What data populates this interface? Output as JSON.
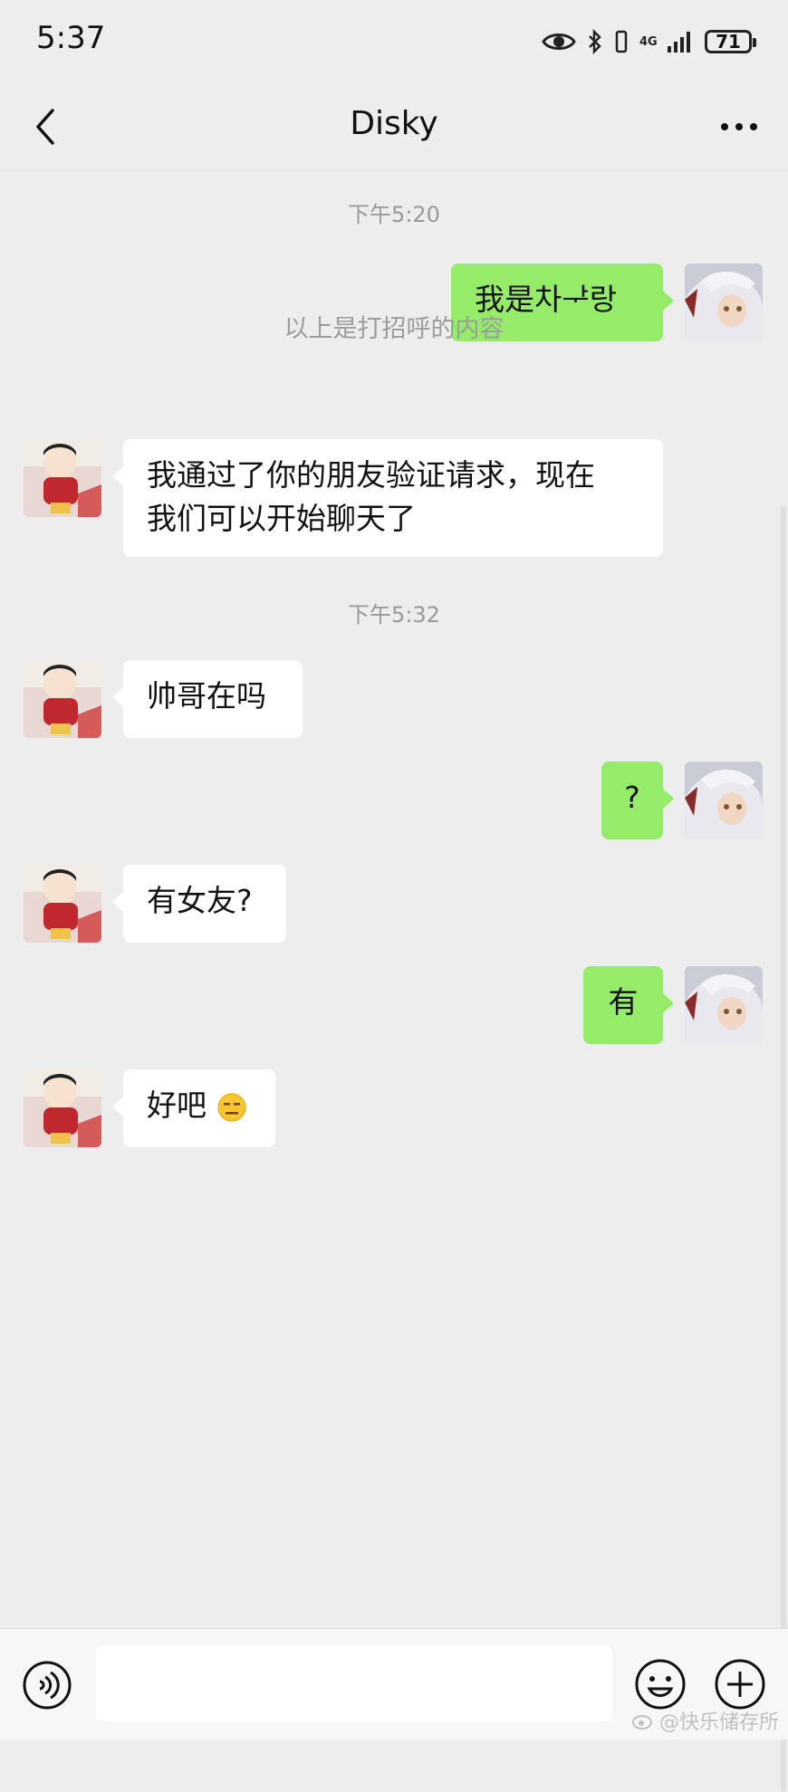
{
  "status_bar": {
    "time": "5:37",
    "network": "4G",
    "battery": "71"
  },
  "nav": {
    "title": "Disky"
  },
  "chat": {
    "timestamp_1": "下午5:20",
    "msg_1": "我是차ᅷ랑",
    "system_notice": "以上是打招呼的内容",
    "msg_2_line1": "我通过了你的朋友验证请求，现在",
    "msg_2_line2": "我们可以开始聊天了",
    "timestamp_2": "下午5:32",
    "msg_3": "帅哥在吗",
    "msg_4": "?",
    "msg_5": "有女友?",
    "msg_6": "有",
    "msg_7": "好吧"
  },
  "watermark": "@快乐储存所",
  "colors": {
    "outgoing_bubble": "#95ec69",
    "incoming_bubble": "#ffffff",
    "background": "#ededed"
  },
  "icons": [
    "back-icon",
    "more-icon",
    "voice-icon",
    "emoji-icon",
    "plus-icon",
    "eye-icon",
    "bluetooth-icon",
    "signal-icon",
    "battery-icon"
  ]
}
